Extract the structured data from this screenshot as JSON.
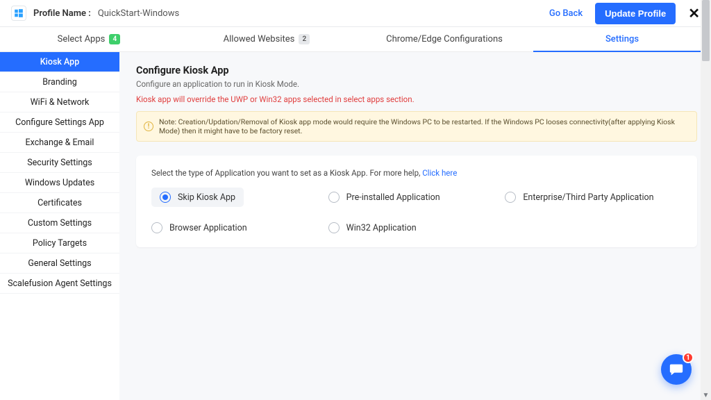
{
  "header": {
    "profile_label": "Profile Name :",
    "profile_value": "QuickStart-Windows",
    "go_back": "Go Back",
    "update_btn": "Update Profile"
  },
  "tabs": [
    {
      "label": "Select Apps",
      "count": "4",
      "count_style": "green"
    },
    {
      "label": "Allowed Websites",
      "count": "2",
      "count_style": "grey"
    },
    {
      "label": "Chrome/Edge Configurations"
    },
    {
      "label": "Settings",
      "active": true
    }
  ],
  "sidebar": [
    "Kiosk App",
    "Branding",
    "WiFi & Network",
    "Configure Settings App",
    "Exchange & Email",
    "Security Settings",
    "Windows Updates",
    "Certificates",
    "Custom Settings",
    "Policy Targets",
    "General Settings",
    "Scalefusion Agent Settings"
  ],
  "sidebar_active_index": 0,
  "content": {
    "title": "Configure Kiosk App",
    "subtitle": "Configure an application to run in Kiosk Mode.",
    "warning": "Kiosk app will override the UWP or Win32 apps selected in select apps section.",
    "note": "Note: Creation/Updation/Removal of Kiosk app mode would require the Windows PC to be restarted. If the Windows PC looses connectivity(after applying Kiosk Mode) then it might have to be factory reset.",
    "help_text": "Select the type of Application you want to set as a Kiosk App. For more help, ",
    "help_link": "Click here",
    "options": [
      "Skip Kiosk App",
      "Pre-installed Application",
      "Enterprise/Third Party Application",
      "Browser Application",
      "Win32 Application"
    ],
    "selected_option_index": 0
  },
  "chat_badge": "1"
}
